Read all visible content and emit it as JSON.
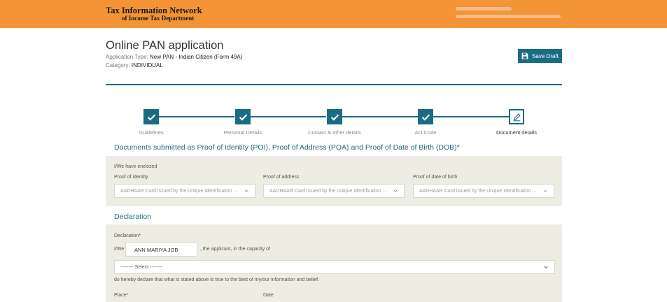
{
  "header": {
    "brand_line1": "Tax Information Network",
    "brand_line2": "of Income Tax Department"
  },
  "page": {
    "title": "Online PAN application",
    "app_type_label": "Application Type:",
    "app_type_value": "New PAN - Indian Citizen (Form 49A)",
    "category_label": "Category:",
    "category_value": "INDIVIDUAL",
    "save_draft": "Save Draft"
  },
  "steps": [
    {
      "label": "Guidelines",
      "status": "done"
    },
    {
      "label": "Personal Details",
      "status": "done"
    },
    {
      "label": "Contact & other details",
      "status": "done"
    },
    {
      "label": "AO Code",
      "status": "done"
    },
    {
      "label": "Document details",
      "status": "current"
    }
  ],
  "documents": {
    "title": "Documents submitted as Proof of Identity (POI), Proof of Address (POA) and Proof of Date of Birth (DOB)*",
    "enclosed_label": "I/We have enclosed",
    "poi_label": "Proof of identity",
    "poi_value": "AADHAAR Card issued by the Unique Identification ...",
    "poa_label": "Proof of address",
    "poa_value": "AADHAAR Card issued by the Unique Identification ...",
    "dob_label": "Proof of date of birth",
    "dob_value": "AADHAAR Card issued by the Unique Identification ..."
  },
  "declaration": {
    "title": "Declaration",
    "label": "Declaration*",
    "iwe": "I/We",
    "name_value": "ANN MARIYA JOB",
    "capacity_text": ", the applicant, in the capacity of",
    "capacity_value": "-------- Select --------",
    "hereby_text": "do hereby declare that what is stated above is true to the best of my/our information and belief.",
    "place_label": "Place*",
    "date_label": "Date"
  },
  "colors": {
    "header_orange": "#f39437",
    "teal": "#1a6c83",
    "panel_bg": "#eeede3"
  }
}
